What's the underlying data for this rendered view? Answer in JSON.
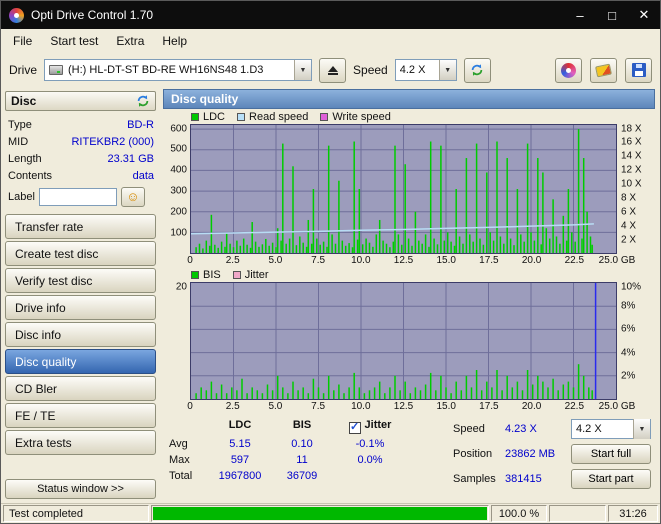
{
  "window": {
    "title": "Opti Drive Control 1.70",
    "controls": {
      "minimize": "–",
      "maximize": "□",
      "close": "✕"
    }
  },
  "menu": {
    "items": [
      "File",
      "Start test",
      "Extra",
      "Help"
    ]
  },
  "toolbar": {
    "drive_label": "Drive",
    "drive_value": "(H:)  HL-DT-ST BD-RE  WH16NS48 1.D3",
    "speed_label": "Speed",
    "speed_value": "4.2 X"
  },
  "icons": {
    "app-icon": "optical-disc",
    "drive-icon": "optical-drive",
    "eject-icon": "eject",
    "refresh-icon": "blue-green-circular-arrows",
    "disc-colors-icon": "colored-disc",
    "erase-icon": "eraser",
    "save-icon": "floppy-disk",
    "label-smiley-icon": "smiley-disc-label",
    "jitter-checkbox": "checked"
  },
  "sidebar": {
    "panel_title": "Disc",
    "info": {
      "type_label": "Type",
      "type_value": "BD-R",
      "mid_label": "MID",
      "mid_value": "RITEKBR2 (000)",
      "length_label": "Length",
      "length_value": "23.31 GB",
      "contents_label": "Contents",
      "contents_value": "data",
      "label_label": "Label"
    },
    "buttons": [
      "Transfer rate",
      "Create test disc",
      "Verify test disc",
      "Drive info",
      "Disc info",
      "Disc quality",
      "CD Bler",
      "FE / TE",
      "Extra tests"
    ],
    "selected_button": "Disc quality",
    "status_button": "Status window >>"
  },
  "main": {
    "header": "Disc quality",
    "legend1": [
      {
        "label": "LDC",
        "color": "#00c800"
      },
      {
        "label": "Read speed",
        "color": "#b8e0f8"
      },
      {
        "label": "Write speed",
        "color": "#e060d8"
      }
    ],
    "legend2": [
      {
        "label": "BIS",
        "color": "#00c800"
      },
      {
        "label": "Jitter",
        "color": "#f0a8c8"
      }
    ]
  },
  "stats": {
    "col_ldc": "LDC",
    "col_bis": "BIS",
    "jitter_label": "Jitter",
    "rows": [
      {
        "label": "Avg",
        "ldc": "5.15",
        "bis": "0.10",
        "jitter": "-0.1%"
      },
      {
        "label": "Max",
        "ldc": "597",
        "bis": "11",
        "jitter": "0.0%"
      },
      {
        "label": "Total",
        "ldc": "1967800",
        "bis": "36709",
        "jitter": ""
      }
    ],
    "speed_label": "Speed",
    "speed_value": "4.23 X",
    "speed_combo": "4.2 X",
    "position_label": "Position",
    "position_value": "23862 MB",
    "samples_label": "Samples",
    "samples_value": "381415",
    "start_full_label": "Start full",
    "start_part_label": "Start part"
  },
  "statusbar": {
    "status": "Test completed",
    "percent": "100.0 %",
    "time": "31:26",
    "progress": 100
  },
  "chart_data": [
    {
      "type": "bar",
      "title": "LDC errors with read speed overlay",
      "xlabel": "GB",
      "xlim": [
        0,
        25
      ],
      "ylim": [
        0,
        620
      ],
      "grid_x": 2.5,
      "grid_y": 100,
      "grid_color": "#6e6e9a",
      "bar_color": "#00cc00",
      "line_color": "#b8dcf4",
      "x_ticks": [
        "0",
        "2.5",
        "5.0",
        "7.5",
        "10.0",
        "12.5",
        "15.0",
        "17.5",
        "20.0",
        "22.5",
        "25.0 GB"
      ],
      "x_tick_values": [
        0,
        2.5,
        5,
        7.5,
        10,
        12.5,
        15,
        17.5,
        20,
        22.5,
        25
      ],
      "left_ticks": [
        {
          "label": "600",
          "value": 600
        },
        {
          "label": "500",
          "value": 500
        },
        {
          "label": "400",
          "value": 400
        },
        {
          "label": "300",
          "value": 300
        },
        {
          "label": "200",
          "value": 200
        },
        {
          "label": "100",
          "value": 100
        }
      ],
      "right_ticks": [
        {
          "label": "18 X",
          "value": 600
        },
        {
          "label": "16 X",
          "value": 533
        },
        {
          "label": "14 X",
          "value": 467
        },
        {
          "label": "12 X",
          "value": 400
        },
        {
          "label": "10 X",
          "value": 333
        },
        {
          "label": "8 X",
          "value": 267
        },
        {
          "label": "6 X",
          "value": 200
        },
        {
          "label": "4 X",
          "value": 133
        },
        {
          "label": "2 X",
          "value": 67
        }
      ],
      "bars": [
        [
          0.3,
          28
        ],
        [
          0.5,
          45
        ],
        [
          0.7,
          22
        ],
        [
          0.9,
          60
        ],
        [
          1.1,
          35
        ],
        [
          1.2,
          185
        ],
        [
          1.4,
          40
        ],
        [
          1.6,
          25
        ],
        [
          1.8,
          55
        ],
        [
          2.0,
          30
        ],
        [
          2.1,
          95
        ],
        [
          2.3,
          45
        ],
        [
          2.5,
          28
        ],
        [
          2.7,
          60
        ],
        [
          2.9,
          35
        ],
        [
          3.1,
          70
        ],
        [
          3.3,
          40
        ],
        [
          3.5,
          25
        ],
        [
          3.6,
          150
        ],
        [
          3.8,
          55
        ],
        [
          4.0,
          30
        ],
        [
          4.2,
          42
        ],
        [
          4.4,
          68
        ],
        [
          4.6,
          35
        ],
        [
          4.8,
          50
        ],
        [
          5.0,
          28
        ],
        [
          5.1,
          120
        ],
        [
          5.3,
          60
        ],
        [
          5.4,
          530
        ],
        [
          5.6,
          45
        ],
        [
          5.8,
          70
        ],
        [
          6.0,
          420
        ],
        [
          6.2,
          38
        ],
        [
          6.4,
          80
        ],
        [
          6.6,
          50
        ],
        [
          6.8,
          30
        ],
        [
          6.9,
          160
        ],
        [
          7.1,
          45
        ],
        [
          7.2,
          310
        ],
        [
          7.4,
          70
        ],
        [
          7.6,
          40
        ],
        [
          7.8,
          55
        ],
        [
          8.0,
          30
        ],
        [
          8.1,
          520
        ],
        [
          8.3,
          90
        ],
        [
          8.5,
          45
        ],
        [
          8.7,
          350
        ],
        [
          8.9,
          60
        ],
        [
          9.1,
          35
        ],
        [
          9.3,
          48
        ],
        [
          9.5,
          28
        ],
        [
          9.6,
          540
        ],
        [
          9.8,
          65
        ],
        [
          9.9,
          310
        ],
        [
          10.1,
          42
        ],
        [
          10.3,
          70
        ],
        [
          10.5,
          50
        ],
        [
          10.7,
          30
        ],
        [
          10.9,
          90
        ],
        [
          11.1,
          160
        ],
        [
          11.3,
          60
        ],
        [
          11.5,
          45
        ],
        [
          11.7,
          28
        ],
        [
          11.9,
          55
        ],
        [
          12.0,
          520
        ],
        [
          12.2,
          90
        ],
        [
          12.4,
          40
        ],
        [
          12.6,
          430
        ],
        [
          12.8,
          70
        ],
        [
          13.0,
          35
        ],
        [
          13.2,
          200
        ],
        [
          13.4,
          60
        ],
        [
          13.6,
          45
        ],
        [
          13.8,
          90
        ],
        [
          14.0,
          30
        ],
        [
          14.1,
          540
        ],
        [
          14.3,
          70
        ],
        [
          14.5,
          42
        ],
        [
          14.7,
          520
        ],
        [
          14.9,
          60
        ],
        [
          15.1,
          100
        ],
        [
          15.3,
          55
        ],
        [
          15.5,
          35
        ],
        [
          15.6,
          310
        ],
        [
          15.8,
          80
        ],
        [
          16.0,
          45
        ],
        [
          16.2,
          460
        ],
        [
          16.4,
          90
        ],
        [
          16.6,
          55
        ],
        [
          16.8,
          530
        ],
        [
          17.0,
          70
        ],
        [
          17.2,
          40
        ],
        [
          17.4,
          390
        ],
        [
          17.6,
          100
        ],
        [
          17.8,
          60
        ],
        [
          18.0,
          540
        ],
        [
          18.2,
          80
        ],
        [
          18.4,
          45
        ],
        [
          18.6,
          460
        ],
        [
          18.8,
          70
        ],
        [
          19.0,
          38
        ],
        [
          19.2,
          310
        ],
        [
          19.4,
          90
        ],
        [
          19.6,
          55
        ],
        [
          19.8,
          530
        ],
        [
          20.0,
          100
        ],
        [
          20.2,
          60
        ],
        [
          20.4,
          460
        ],
        [
          20.6,
          42
        ],
        [
          20.7,
          390
        ],
        [
          20.9,
          120
        ],
        [
          21.1,
          70
        ],
        [
          21.3,
          260
        ],
        [
          21.5,
          80
        ],
        [
          21.7,
          45
        ],
        [
          21.9,
          180
        ],
        [
          22.1,
          60
        ],
        [
          22.2,
          310
        ],
        [
          22.4,
          100
        ],
        [
          22.6,
          55
        ],
        [
          22.8,
          600
        ],
        [
          23.0,
          70
        ],
        [
          23.1,
          460
        ],
        [
          23.3,
          200
        ],
        [
          23.5,
          80
        ],
        [
          23.6,
          40
        ]
      ],
      "line": {
        "name": "Read speed",
        "points": [
          [
            0,
            93
          ],
          [
            2.5,
            97
          ],
          [
            5,
            101
          ],
          [
            7.5,
            105
          ],
          [
            10,
            110
          ],
          [
            12.5,
            114
          ],
          [
            15,
            119
          ],
          [
            17.5,
            124
          ],
          [
            20,
            130
          ],
          [
            22.5,
            136
          ],
          [
            23.7,
            141
          ]
        ]
      }
    },
    {
      "type": "bar",
      "title": "BIS errors with jitter overlay",
      "xlabel": "GB",
      "xlim": [
        0,
        25
      ],
      "ylim": [
        0,
        20
      ],
      "grid_x": 2.5,
      "grid_y": 4,
      "grid_color": "#6e6e9a",
      "bar_color": "#00cc00",
      "cursor_x": 23.8,
      "cursor_color": "#2a2aee",
      "x_ticks": [
        "0",
        "2.5",
        "5.0",
        "7.5",
        "10.0",
        "12.5",
        "15.0",
        "17.5",
        "20.0",
        "22.5",
        "25.0 GB"
      ],
      "x_tick_values": [
        0,
        2.5,
        5,
        7.5,
        10,
        12.5,
        15,
        17.5,
        20,
        22.5,
        25
      ],
      "left_ticks": [
        {
          "label": "20",
          "value": 20
        }
      ],
      "right_ticks": [
        {
          "label": "10%",
          "value": 20
        },
        {
          "label": "8%",
          "value": 16
        },
        {
          "label": "6%",
          "value": 12
        },
        {
          "label": "4%",
          "value": 8
        },
        {
          "label": "2%",
          "value": 4
        }
      ],
      "bars": [
        [
          0.3,
          1
        ],
        [
          0.6,
          2
        ],
        [
          0.9,
          1.5
        ],
        [
          1.2,
          3
        ],
        [
          1.5,
          1
        ],
        [
          1.8,
          2.5
        ],
        [
          2.1,
          1
        ],
        [
          2.4,
          2
        ],
        [
          2.7,
          1.5
        ],
        [
          3.0,
          3.5
        ],
        [
          3.3,
          1
        ],
        [
          3.6,
          2
        ],
        [
          3.9,
          1.5
        ],
        [
          4.2,
          1
        ],
        [
          4.5,
          2.5
        ],
        [
          4.8,
          1.5
        ],
        [
          5.1,
          4
        ],
        [
          5.4,
          2
        ],
        [
          5.7,
          1
        ],
        [
          6.0,
          3
        ],
        [
          6.3,
          1.5
        ],
        [
          6.6,
          2
        ],
        [
          6.9,
          1
        ],
        [
          7.2,
          3.5
        ],
        [
          7.5,
          2
        ],
        [
          7.8,
          1
        ],
        [
          8.1,
          4
        ],
        [
          8.4,
          1.5
        ],
        [
          8.7,
          2.5
        ],
        [
          9.0,
          1
        ],
        [
          9.3,
          2
        ],
        [
          9.6,
          4.5
        ],
        [
          9.9,
          2
        ],
        [
          10.2,
          1
        ],
        [
          10.5,
          1.5
        ],
        [
          10.8,
          2
        ],
        [
          11.1,
          3
        ],
        [
          11.4,
          1
        ],
        [
          11.7,
          2
        ],
        [
          12.0,
          4
        ],
        [
          12.3,
          1.5
        ],
        [
          12.6,
          3
        ],
        [
          12.9,
          1
        ],
        [
          13.2,
          2
        ],
        [
          13.5,
          1.5
        ],
        [
          13.8,
          2.5
        ],
        [
          14.1,
          4.5
        ],
        [
          14.4,
          1.5
        ],
        [
          14.7,
          4
        ],
        [
          15.0,
          2
        ],
        [
          15.3,
          1
        ],
        [
          15.6,
          3
        ],
        [
          15.9,
          1.5
        ],
        [
          16.2,
          4
        ],
        [
          16.5,
          2
        ],
        [
          16.8,
          5
        ],
        [
          17.1,
          1.5
        ],
        [
          17.4,
          3
        ],
        [
          17.7,
          2
        ],
        [
          18.0,
          5
        ],
        [
          18.3,
          1.5
        ],
        [
          18.6,
          4
        ],
        [
          18.9,
          2
        ],
        [
          19.2,
          3
        ],
        [
          19.5,
          1.5
        ],
        [
          19.8,
          5
        ],
        [
          20.1,
          2.5
        ],
        [
          20.4,
          4
        ],
        [
          20.7,
          3
        ],
        [
          21.0,
          2
        ],
        [
          21.3,
          3.5
        ],
        [
          21.6,
          1.5
        ],
        [
          21.9,
          2.5
        ],
        [
          22.2,
          3
        ],
        [
          22.5,
          2
        ],
        [
          22.8,
          6
        ],
        [
          23.1,
          4
        ],
        [
          23.4,
          2
        ],
        [
          23.6,
          1.5
        ]
      ]
    }
  ]
}
